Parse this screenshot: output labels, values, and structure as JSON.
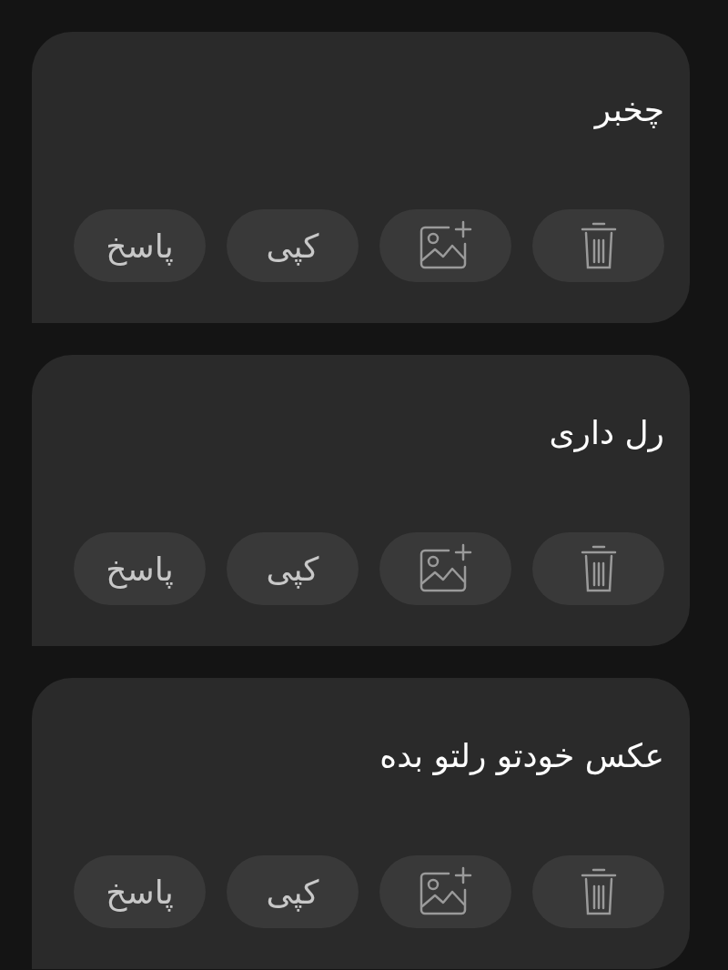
{
  "messages": [
    {
      "text": "چخبر",
      "actions": [
        {
          "kind": "delete"
        },
        {
          "kind": "add-image"
        },
        {
          "kind": "text",
          "label": "کپی"
        },
        {
          "kind": "text",
          "label": "پاسخ"
        }
      ]
    },
    {
      "text": "رل داری",
      "actions": [
        {
          "kind": "delete"
        },
        {
          "kind": "add-image"
        },
        {
          "kind": "text",
          "label": "کپی"
        },
        {
          "kind": "text",
          "label": "پاسخ"
        }
      ]
    },
    {
      "text": "عکس خودتو رلتو بده",
      "actions": [
        {
          "kind": "delete"
        },
        {
          "kind": "add-image"
        },
        {
          "kind": "text",
          "label": "کپی"
        },
        {
          "kind": "text",
          "label": "پاسخ"
        }
      ]
    }
  ]
}
